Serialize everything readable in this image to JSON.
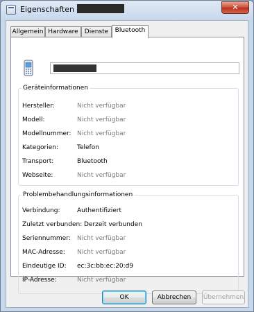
{
  "window": {
    "title": "Eigenschaften von",
    "close_label": "✕"
  },
  "tabs": [
    {
      "label": "Allgemein"
    },
    {
      "label": "Hardware"
    },
    {
      "label": "Dienste"
    },
    {
      "label": "Bluetooth"
    }
  ],
  "device_info": {
    "title": "Geräteinformationen",
    "rows": [
      {
        "label": "Hersteller:",
        "value": "Nicht verfügbar"
      },
      {
        "label": "Modell:",
        "value": "Nicht verfügbar"
      },
      {
        "label": "Modellnummer:",
        "value": "Nicht verfügbar"
      },
      {
        "label": "Kategorien:",
        "value": "Telefon"
      },
      {
        "label": "Transport:",
        "value": "Bluetooth"
      },
      {
        "label": "Webseite:",
        "value": "Nicht verfügbar"
      }
    ]
  },
  "troubleshoot_info": {
    "title": "Problembehandlungsinformationen",
    "rows": [
      {
        "label": "Verbindung:",
        "value": "Authentifiziert"
      },
      {
        "label": "Zuletzt verbunden:",
        "value": "Derzeit verbunden"
      },
      {
        "label": "Seriennummer:",
        "value": "Nicht verfügbar"
      },
      {
        "label": "MAC-Adresse:",
        "value": "Nicht verfügbar"
      },
      {
        "label": "Eindeutige ID:",
        "value": "ec:3c:bb:ec:20:d9"
      },
      {
        "label": "IP-Adresse:",
        "value": "Nicht verfügbar"
      }
    ]
  },
  "buttons": {
    "ok": "OK",
    "cancel": "Abbrechen",
    "apply": "Übernehmen"
  }
}
